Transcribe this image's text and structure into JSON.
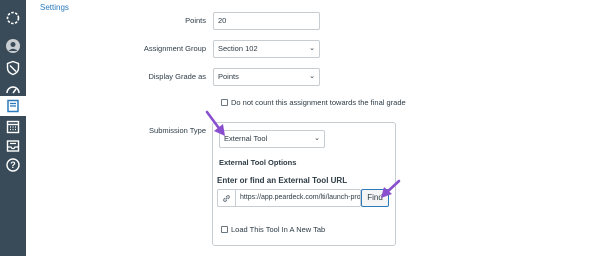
{
  "sidebar": {
    "items": [
      {
        "icon": "dashboard-icon"
      },
      {
        "icon": "account-icon"
      },
      {
        "icon": "shield-icon"
      },
      {
        "icon": "speedometer-icon"
      },
      {
        "icon": "courses-icon",
        "active": true
      },
      {
        "icon": "calendar-icon"
      },
      {
        "icon": "inbox-icon"
      },
      {
        "icon": "help-icon"
      }
    ]
  },
  "header": {
    "settings_link": "Settings"
  },
  "form": {
    "points": {
      "label": "Points",
      "value": "20"
    },
    "assignment_group": {
      "label": "Assignment Group",
      "selected": "Section 102"
    },
    "display_grade": {
      "label": "Display Grade as",
      "selected": "Points"
    },
    "dont_count": {
      "label": "Do not count this assignment towards the final grade",
      "checked": false
    },
    "submission_type": {
      "label": "Submission Type",
      "selected": "External Tool",
      "options_title": "External Tool Options",
      "url_title": "Enter or find an External Tool URL",
      "url_value": "https://app.peardeck.com/lti/launch-pro",
      "find_label": "Find",
      "new_tab": {
        "label": "Load This Tool In A New Tab",
        "checked": false
      }
    }
  },
  "colors": {
    "sidebar": "#394b58",
    "link": "#2b7abc",
    "arrow": "#8a4fcf"
  }
}
